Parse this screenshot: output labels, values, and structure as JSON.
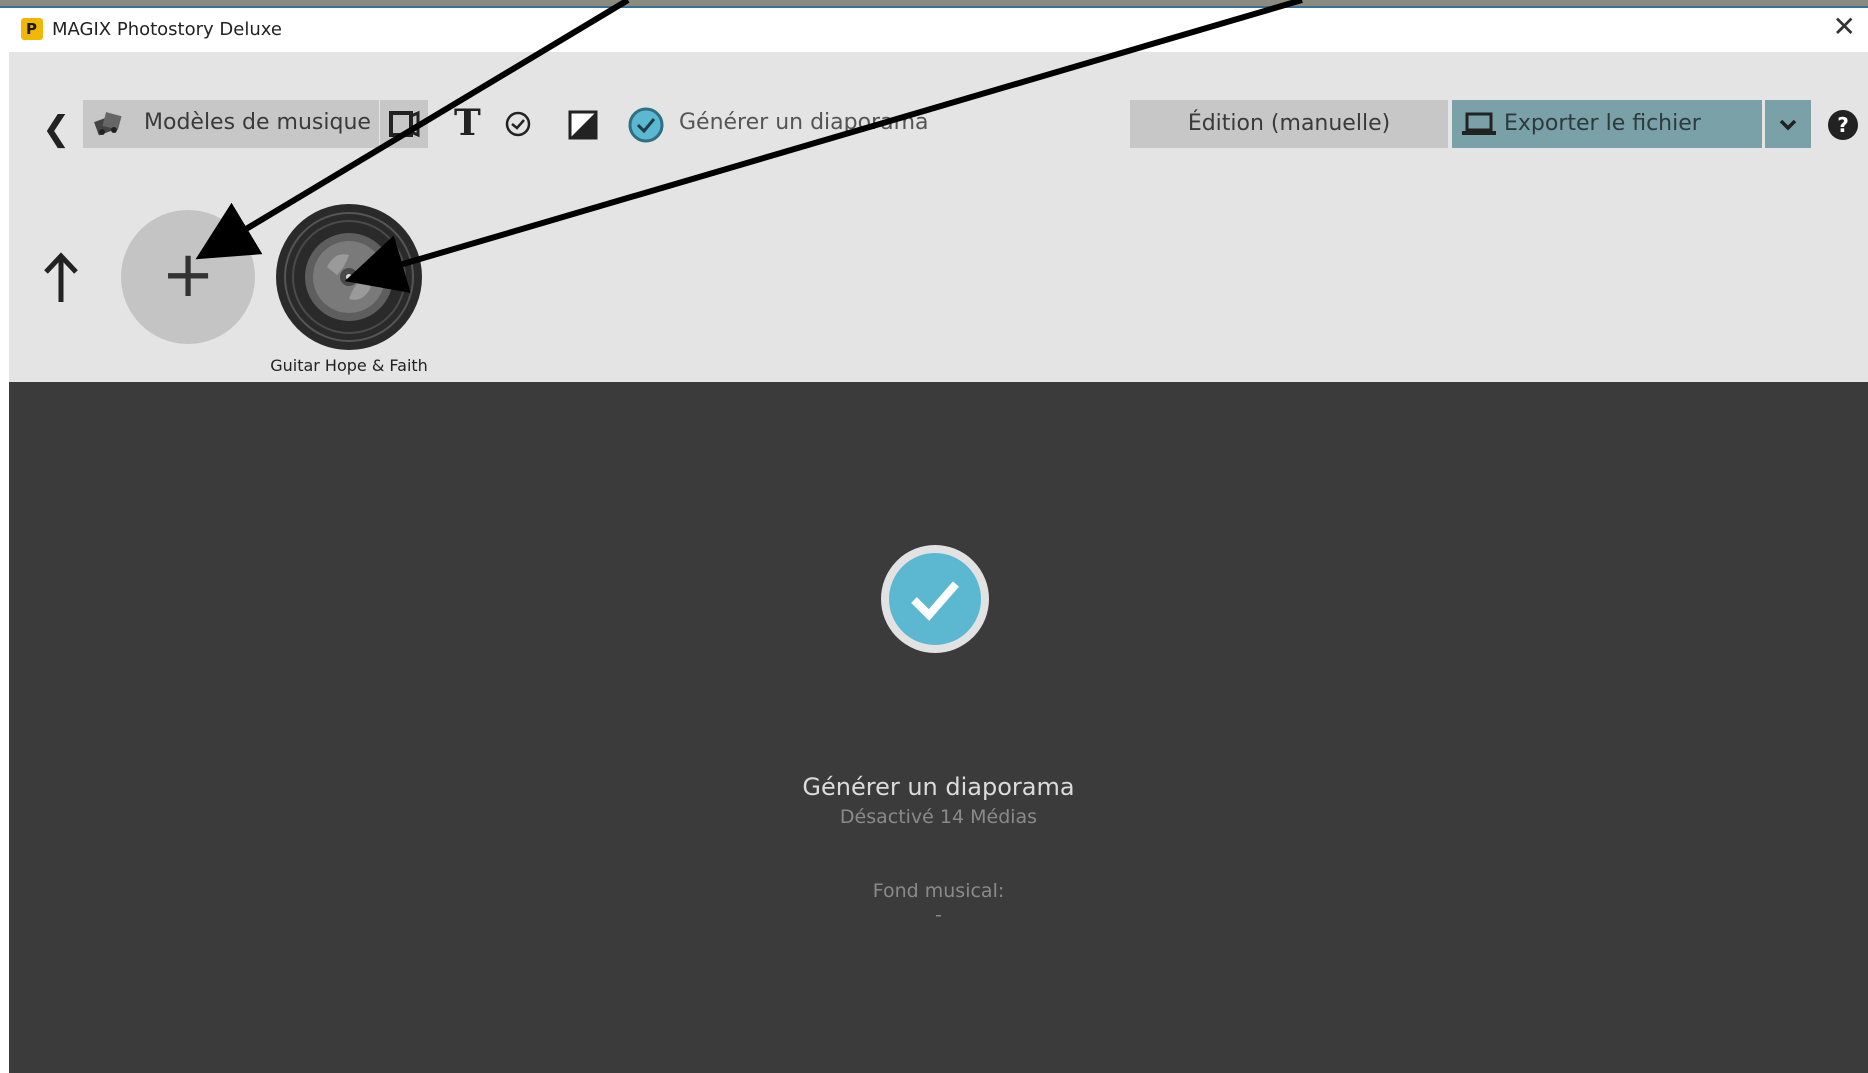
{
  "window": {
    "title": "MAGIX Photostory Deluxe",
    "app_icon_letter": "P",
    "close_glyph": "✕"
  },
  "toolbar": {
    "back_glyph": "❮",
    "music_templates_label": "Modèles de musique",
    "text_tool_glyph": "T",
    "generate_label": "Générer un diaporama",
    "edit_manual_label": "Édition (manuelle)",
    "export_label": "Exporter le fichier",
    "help_glyph": "?"
  },
  "media_bar": {
    "add_glyph": "+",
    "items": [
      {
        "label": "Guitar Hope & Faith",
        "icon": "music-disc-icon"
      }
    ]
  },
  "panel": {
    "title": "Générer un diaporama",
    "subtitle": "Désactivé 14 Médias",
    "music_label": "Fond musical:",
    "music_value": "-"
  },
  "colors": {
    "accent_teal": "#5bb8d0",
    "export_button": "#7aa1a8",
    "dark_panel": "#3b3b3b",
    "toolbar_bg": "#e4e4e4"
  }
}
